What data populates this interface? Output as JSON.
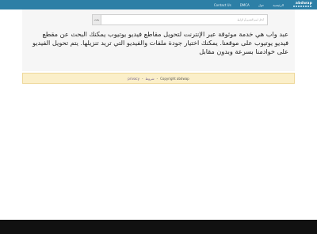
{
  "navbar": {
    "brand": "abdwap",
    "links": [
      "Contact Us",
      "DMCA",
      "حول",
      "الرئيسية"
    ]
  },
  "search": {
    "button_label": "بحث",
    "placeholder": "أدخل اسم الفيديو أو الرابط"
  },
  "description": "عبد واب هي خدمة موثوقة عبر الإنترنت لتحويل مقاطع فيديو يوتيوب يمكنك البحث عن مقطع فيديو يوتيوب على موقعنا. يمكنك اختيار جودة ملفات والفيديو التي تريد تنزيلها. يتم تحويل الفيديو على خوادمنا بسرعة وبدون مقابل",
  "footer": {
    "privacy_label": "privacy",
    "terms_label": "شروط",
    "copyright": "Copyright abdwap"
  }
}
